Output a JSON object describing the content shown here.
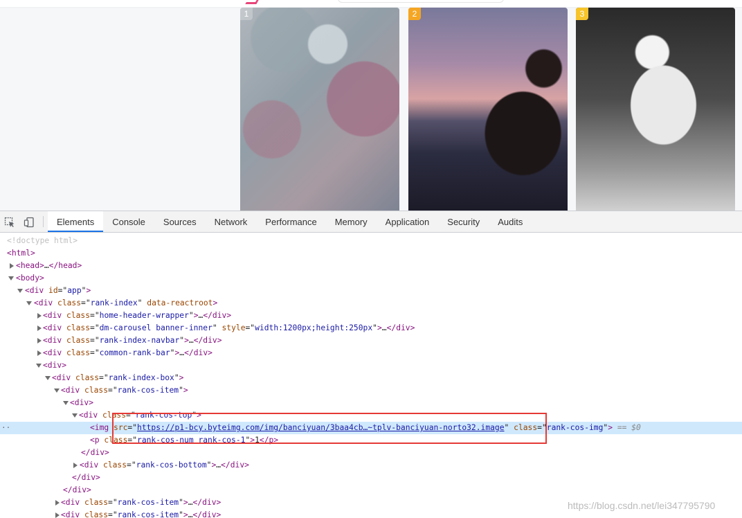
{
  "page": {
    "cards": [
      {
        "rank": "1"
      },
      {
        "rank": "2"
      },
      {
        "rank": "3"
      }
    ]
  },
  "devtools": {
    "tabs": [
      "Elements",
      "Console",
      "Sources",
      "Network",
      "Performance",
      "Memory",
      "Application",
      "Security",
      "Audits"
    ],
    "active_tab": "Elements",
    "icons": {
      "inspect": "inspect-element-icon",
      "device": "device-toolbar-icon"
    },
    "dom": {
      "doctype": "<!doctype html>",
      "html": "html",
      "head": "head",
      "body": "body",
      "ellipsis": "…",
      "app_id": "app",
      "rank_index_class": "rank-index",
      "data_reactroot": "data-reactroot",
      "home_header": "home-header-wrapper",
      "carousel_class": "dm-carousel banner-inner",
      "carousel_style": "width:1200px;height:250px",
      "navbar": "rank-index-navbar",
      "common_rank_bar": "common-rank-bar",
      "rank_index_box": "rank-index-box",
      "rank_cos_item": "rank-cos-item",
      "rank_cos_top": "rank-cos-top",
      "img_src": "https://p1-bcy.byteimg.com/img/banciyuan/3baa4cb…~tplv-banciyuan-norto32.image",
      "img_class": "rank-cos-img",
      "selected_marker": "== $0",
      "p_class": "rank-cos-num rank-cos-1",
      "p_text": "1",
      "rank_cos_bottom": "rank-cos-bottom"
    }
  },
  "watermark": "https://blog.csdn.net/lei347795790"
}
